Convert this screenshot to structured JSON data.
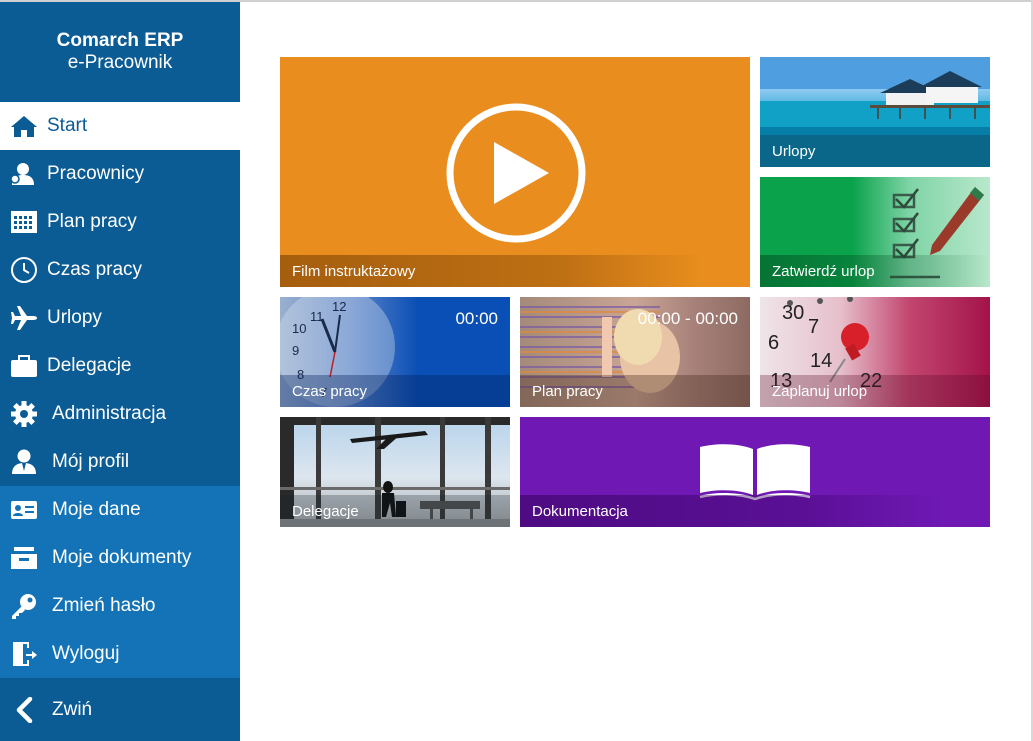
{
  "brand": {
    "title": "Comarch ERP",
    "subtitle": "e-Pracownik"
  },
  "nav": [
    {
      "label": "Start",
      "icon": "home-icon"
    },
    {
      "label": "Pracownicy",
      "icon": "users-icon"
    },
    {
      "label": "Plan pracy",
      "icon": "calendar-grid-icon"
    },
    {
      "label": "Czas pracy",
      "icon": "clock-icon"
    },
    {
      "label": "Urlopy",
      "icon": "plane-icon"
    },
    {
      "label": "Delegacje",
      "icon": "briefcase-icon"
    },
    {
      "label": "Administracja",
      "icon": "gear-icon"
    },
    {
      "label": "Mój profil",
      "icon": "user-icon"
    },
    {
      "label": "Moje dane",
      "icon": "id-card-icon"
    },
    {
      "label": "Moje dokumenty",
      "icon": "inbox-icon"
    },
    {
      "label": "Zmień hasło",
      "icon": "key-icon"
    },
    {
      "label": "Wyloguj",
      "icon": "logout-icon"
    }
  ],
  "collapse_label": "Zwiń",
  "tiles": {
    "film": {
      "label": "Film instruktażowy",
      "color": "#e98e1e"
    },
    "urlopy": {
      "label": "Urlopy"
    },
    "zatwierdz": {
      "label": "Zatwierdź urlop",
      "color": "#0aa24b"
    },
    "czas": {
      "label": "Czas pracy",
      "time": "00:00",
      "color": "#0a4fb5"
    },
    "plan": {
      "label": "Plan pracy",
      "time": "00:00 - 00:00"
    },
    "zaplanuj": {
      "label": "Zaplanuj urlop",
      "color": "#a3134a"
    },
    "delegacje": {
      "label": "Delegacje"
    },
    "dokumentacja": {
      "label": "Dokumentacja",
      "color": "#6f18b4"
    }
  }
}
